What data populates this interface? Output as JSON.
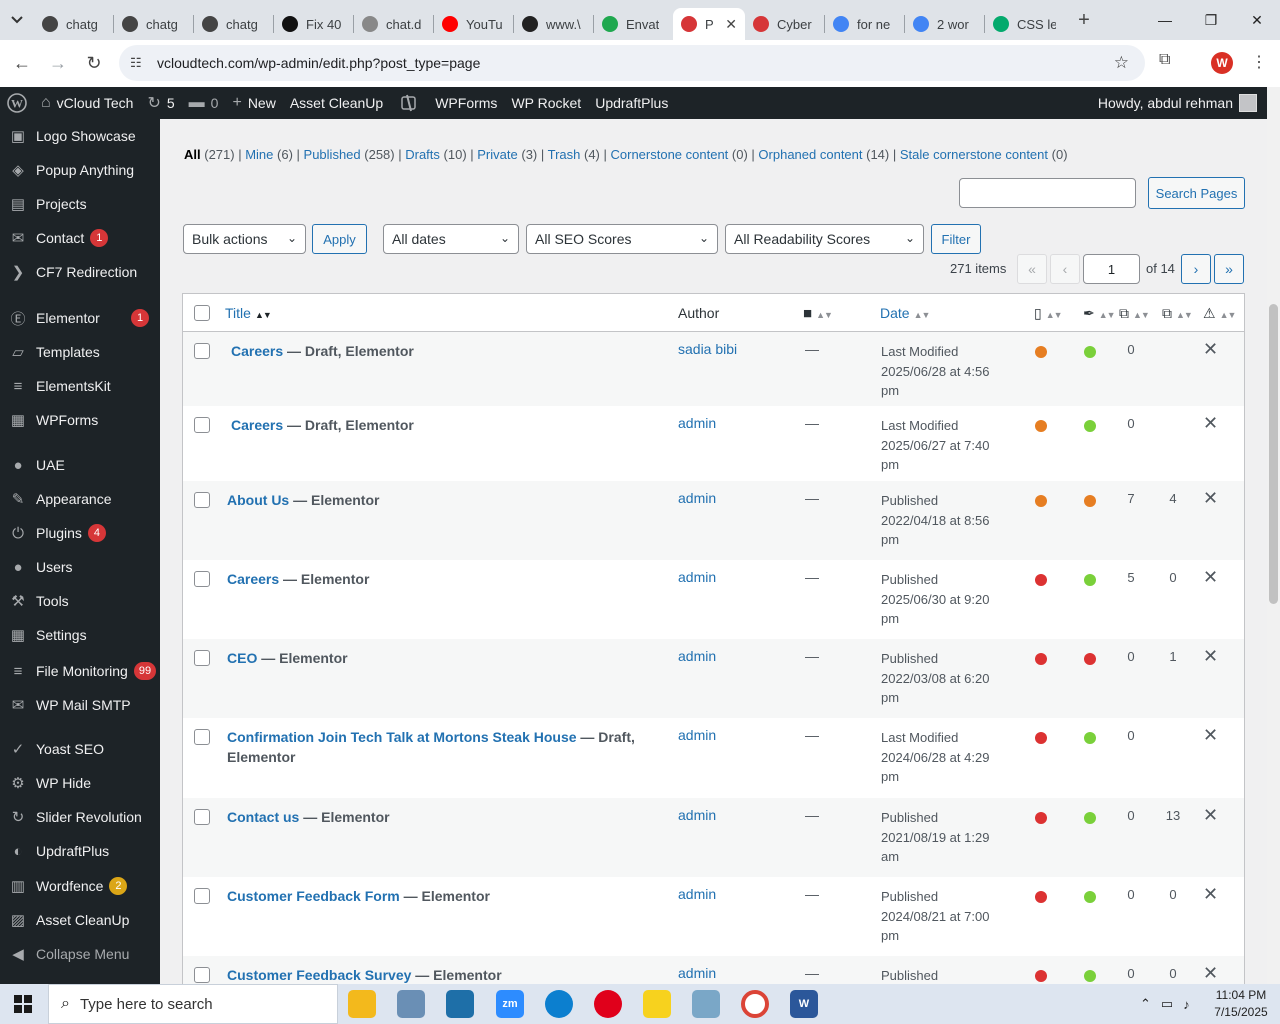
{
  "browser": {
    "tabs": [
      {
        "label": "chatg",
        "icon": "chatgpt-icon",
        "color": "#444444"
      },
      {
        "label": "chatg",
        "icon": "chatgpt-icon",
        "color": "#444444"
      },
      {
        "label": "chatg",
        "icon": "chatgpt-icon",
        "color": "#444444"
      },
      {
        "label": "Fix 40",
        "icon": "openai-icon",
        "color": "#111111"
      },
      {
        "label": "chat.d",
        "icon": "deepseek-icon",
        "color": "#888888"
      },
      {
        "label": "YouTu",
        "icon": "youtube-icon",
        "color": "#ff0000"
      },
      {
        "label": "www.\\",
        "icon": "wix-icon",
        "color": "#222222"
      },
      {
        "label": "Envat",
        "icon": "envato-icon",
        "color": "#1fa84f"
      },
      {
        "label": "P",
        "icon": "wordpress-red-icon",
        "color": "#d63638",
        "active": true
      },
      {
        "label": "Cyber",
        "icon": "wordpress-red-icon",
        "color": "#d63638"
      },
      {
        "label": "for ne",
        "icon": "google-icon",
        "color": "#4285f4"
      },
      {
        "label": "2 wor",
        "icon": "google-icon",
        "color": "#4285f4"
      },
      {
        "label": "CSS le",
        "icon": "w3schools-icon",
        "color": "#04aa6d"
      }
    ],
    "url": "vcloudtech.com/wp-admin/edit.php?post_type=page",
    "profile_initial": "W"
  },
  "adminbar": {
    "site": "vCloud Tech",
    "updates": "5",
    "comments": "0",
    "new_label": "New",
    "items": [
      "Asset CleanUp",
      "WPForms",
      "WP Rocket",
      "UpdraftPlus"
    ],
    "howdy": "Howdy, abdul rehman"
  },
  "sidebar": {
    "items": [
      {
        "label": "Logo Showcase",
        "icon": "logo-icon"
      },
      {
        "label": "Popup Anything",
        "icon": "popup-icon"
      },
      {
        "label": "Projects",
        "icon": "projects-icon"
      },
      {
        "label": "Contact",
        "icon": "mail-icon",
        "badge": "1"
      },
      {
        "label": "CF7 Redirection",
        "icon": "redirect-icon"
      },
      {
        "label": "Elementor",
        "icon": "elementor-icon",
        "badge": "1"
      },
      {
        "label": "Templates",
        "icon": "folder-icon"
      },
      {
        "label": "ElementsKit",
        "icon": "elementskit-icon"
      },
      {
        "label": "WPForms",
        "icon": "forms-icon"
      },
      {
        "label": "UAE",
        "icon": "uae-icon"
      },
      {
        "label": "Appearance",
        "icon": "brush-icon"
      },
      {
        "label": "Plugins",
        "icon": "plugin-icon",
        "badge": "4"
      },
      {
        "label": "Users",
        "icon": "user-icon"
      },
      {
        "label": "Tools",
        "icon": "wrench-icon"
      },
      {
        "label": "Settings",
        "icon": "settings-icon"
      },
      {
        "label": "File Monitoring",
        "icon": "file-monitor-icon",
        "badge": "99"
      },
      {
        "label": "WP Mail SMTP",
        "icon": "smtp-icon"
      },
      {
        "label": "Yoast SEO",
        "icon": "yoast-icon"
      },
      {
        "label": "WP Hide",
        "icon": "hide-icon"
      },
      {
        "label": "Slider Revolution",
        "icon": "slider-icon"
      },
      {
        "label": "UpdraftPlus",
        "icon": "updraft-icon"
      },
      {
        "label": "Wordfence",
        "icon": "wordfence-icon",
        "badge": "2"
      },
      {
        "label": "Asset CleanUp",
        "icon": "asset-cleanup-icon"
      },
      {
        "label": "Collapse Menu",
        "icon": "collapse-icon"
      }
    ]
  },
  "filters": {
    "views": [
      {
        "label": "All",
        "count": "(271)"
      },
      {
        "label": "Mine",
        "count": "(6)"
      },
      {
        "label": "Published",
        "count": "(258)"
      },
      {
        "label": "Drafts",
        "count": "(10)"
      },
      {
        "label": "Private",
        "count": "(3)"
      },
      {
        "label": "Trash",
        "count": "(4)"
      },
      {
        "label": "Cornerstone content",
        "count": "(0)"
      },
      {
        "label": "Orphaned content",
        "count": "(14)"
      },
      {
        "label": "Stale cornerstone content",
        "count": "(0)"
      }
    ],
    "search_button": "Search Pages",
    "bulk_actions": "Bulk actions",
    "apply": "Apply",
    "dates": "All dates",
    "seo_scores": "All SEO Scores",
    "readability": "All Readability Scores",
    "filter": "Filter",
    "items_count": "271 items",
    "page": "1",
    "of_pages": "of 14",
    "first": "«",
    "prev": "‹",
    "next": "›",
    "last": "»"
  },
  "table": {
    "columns": {
      "title": "Title",
      "author": "Author",
      "date": "Date"
    },
    "rows": [
      {
        "title": "Careers",
        "suffix": " — Draft, Elementor",
        "author": "sadia bibi",
        "comments": "—",
        "date": [
          "Last Modified",
          "2025/06/28 at 4:56",
          "pm"
        ],
        "seo": "#e67e22",
        "read": "#7ad03a",
        "links": "0",
        "inbound": ""
      },
      {
        "title": "Careers",
        "suffix": " — Draft, Elementor",
        "author": "admin",
        "comments": "—",
        "date": [
          "Last Modified",
          "2025/06/27 at 7:40",
          "pm"
        ],
        "seo": "#e67e22",
        "read": "#7ad03a",
        "links": "0",
        "inbound": ""
      },
      {
        "title": "About Us",
        "suffix": " — Elementor",
        "author": "admin",
        "comments": "—",
        "date": [
          "Published",
          "2022/04/18 at 8:56",
          "pm"
        ],
        "seo": "#e67e22",
        "read": "#e67e22",
        "links": "7",
        "inbound": "4"
      },
      {
        "title": "Careers",
        "suffix": " — Elementor",
        "author": "admin",
        "comments": "—",
        "date": [
          "Published",
          "2025/06/30 at 9:20",
          "pm"
        ],
        "seo": "#dc3232",
        "read": "#7ad03a",
        "links": "5",
        "inbound": "0"
      },
      {
        "title": "CEO",
        "suffix": " — Elementor",
        "author": "admin",
        "comments": "—",
        "date": [
          "Published",
          "2022/03/08 at 6:20",
          "pm"
        ],
        "seo": "#dc3232",
        "read": "#dc3232",
        "links": "0",
        "inbound": "1"
      },
      {
        "title": "Confirmation Join Tech Talk at Mortons Steak House",
        "suffix": " — Draft, Elementor",
        "author": "admin",
        "comments": "—",
        "date": [
          "Last Modified",
          "2024/06/28 at 4:29",
          "pm"
        ],
        "seo": "#dc3232",
        "read": "#7ad03a",
        "links": "0",
        "inbound": ""
      },
      {
        "title": "Contact us",
        "suffix": " — Elementor",
        "author": "admin",
        "comments": "—",
        "date": [
          "Published",
          "2021/08/19 at 1:29",
          "am"
        ],
        "seo": "#dc3232",
        "read": "#7ad03a",
        "links": "0",
        "inbound": "13"
      },
      {
        "title": "Customer Feedback Form",
        "suffix": " — Elementor",
        "author": "admin",
        "comments": "—",
        "date": [
          "Published",
          "2024/08/21 at 7:00",
          "pm"
        ],
        "seo": "#dc3232",
        "read": "#7ad03a",
        "links": "0",
        "inbound": "0"
      },
      {
        "title": "Customer Feedback Survey",
        "suffix": " — Elementor",
        "author": "admin",
        "comments": "—",
        "date": [
          "Published",
          "",
          ""
        ],
        "seo": "#dc3232",
        "read": "#7ad03a",
        "links": "0",
        "inbound": "0"
      }
    ]
  },
  "taskbar": {
    "search_placeholder": "Type here to search",
    "time": "11:04 PM",
    "date": "7/15/2025"
  }
}
